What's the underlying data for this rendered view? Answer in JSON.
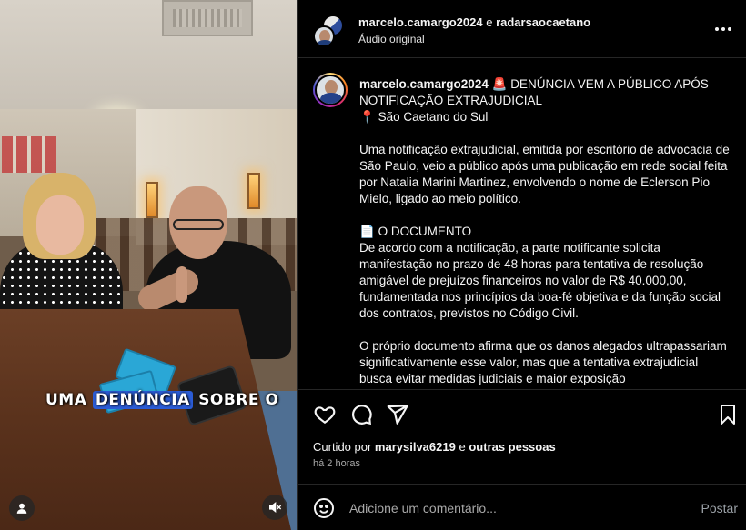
{
  "media": {
    "caption_overlay_pre": "UMA",
    "caption_overlay_highlight": "DENÚNCIA",
    "caption_overlay_post": "SOBRE O",
    "user_tag_icon": "user-icon",
    "mute_icon": "speaker-muted-icon"
  },
  "header": {
    "author": "marcelo.camargo2024",
    "connector": " e ",
    "coauthor": "radarsaocaetano",
    "audio": "Áudio original",
    "more_icon": "more-horizontal-icon"
  },
  "caption": {
    "username": "marcelo.camargo2024",
    "siren_emoji": "🚨",
    "headline": "DENÚNCIA VEM A PÚBLICO APÓS NOTIFICAÇÃO EXTRAJUDICIAL",
    "pin_emoji": "📍",
    "location": "São Caetano do Sul",
    "paragraph1": "Uma notificação extrajudicial, emitida por escritório de advocacia de São Paulo, veio a público após uma publicação em rede social feita por Natalia Marini Martinez, envolvendo o nome de Eclerson Pio Mielo, ligado ao meio político.",
    "doc_emoji": "📄",
    "doc_heading": "O DOCUMENTO",
    "paragraph2": "De acordo com a notificação, a parte notificante solicita manifestação no prazo de 48 horas para tentativa de resolução amigável de prejuízos financeiros no valor de R$ 40.000,00, fundamentada nos princípios da boa-fé objetiva e da função social dos contratos, previstos no Código Civil.",
    "paragraph3": "O próprio documento afirma que os danos alegados ultrapassariam significativamente esse valor, mas que a tentativa extrajudicial busca evitar medidas judiciais e maior exposição"
  },
  "actions": {
    "like_icon": "heart-icon",
    "comment_icon": "comment-icon",
    "share_icon": "send-icon",
    "save_icon": "bookmark-icon"
  },
  "likes": {
    "prefix": "Curtido por ",
    "user": "marysilva6219",
    "middle": " e ",
    "others": "outras pessoas"
  },
  "time": "há 2 horas",
  "comment": {
    "emoji_icon": "emoji-icon",
    "placeholder": "Adicione um comentário...",
    "post_label": "Postar"
  },
  "colors": {
    "background": "#000000",
    "text": "#f5f5f5",
    "muted": "#a8a8a8",
    "caption_highlight": "#2b5cd6",
    "watch_orange": "#f07a1a"
  }
}
